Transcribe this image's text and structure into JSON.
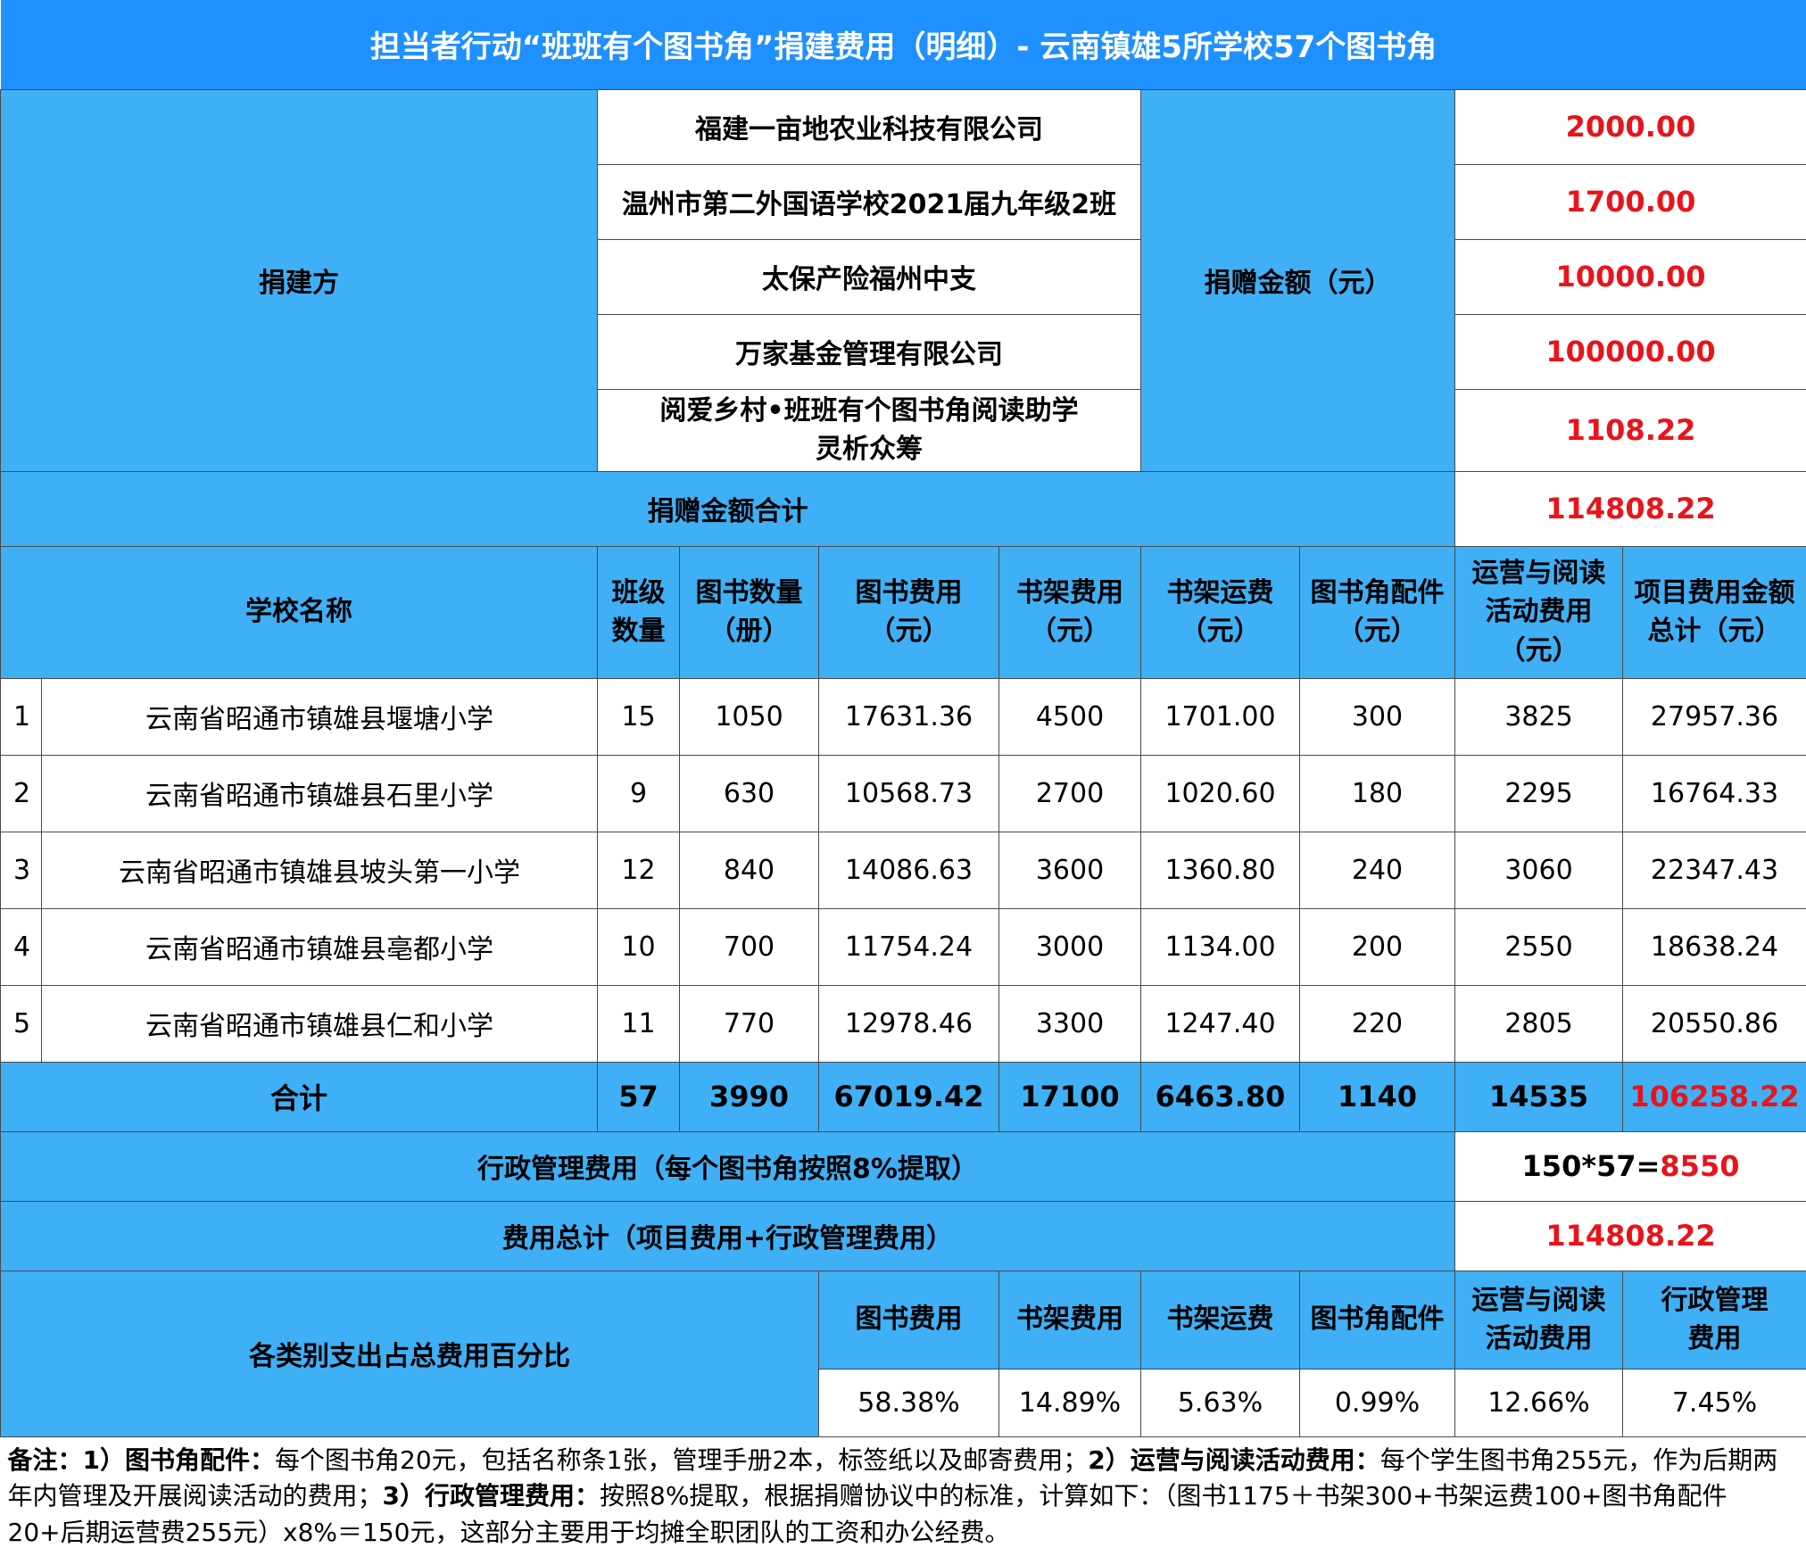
{
  "title": "担当者行动“班班有个图书角”捐建费用（明细）- 云南镇雄5所学校57个图书角",
  "donors": {
    "label": "捐建方",
    "amount_label": "捐赠金额（元）",
    "rows": [
      {
        "name": "福建一亩地农业科技有限公司",
        "amount": "2000.00"
      },
      {
        "name": "温州市第二外国语学校2021届九年级2班",
        "amount": "1700.00"
      },
      {
        "name": "太保产险福州中支",
        "amount": "10000.00"
      },
      {
        "name": "万家基金管理有限公司",
        "amount": "100000.00"
      },
      {
        "name_line1": "阅爱乡村•班班有个图书角阅读助学",
        "name_line2": "灵析众筹",
        "amount": "1108.22"
      }
    ],
    "total_label": "捐赠金额合计",
    "total": "114808.22"
  },
  "schools": {
    "headers": {
      "school": "学校名称",
      "classes_1": "班级",
      "classes_2": "数量",
      "books_1": "图书数量",
      "books_2": "（册）",
      "book_cost_1": "图书费用",
      "book_cost_2": "（元）",
      "shelf_cost_1": "书架费用",
      "shelf_cost_2": "（元）",
      "shelf_ship_1": "书架运费",
      "shelf_ship_2": "（元）",
      "accessory_1": "图书角配件",
      "accessory_2": "（元）",
      "ops_1": "运营与阅读",
      "ops_2": "活动费用",
      "ops_3": "（元）",
      "total_1": "项目费用金额",
      "total_2": "总计（元）"
    },
    "rows": [
      {
        "idx": "1",
        "name": "云南省昭通市镇雄县堰塘小学",
        "classes": "15",
        "books": "1050",
        "book_cost": "17631.36",
        "shelf_cost": "4500",
        "shelf_ship": "1701.00",
        "accessory": "300",
        "ops": "3825",
        "total": "27957.36"
      },
      {
        "idx": "2",
        "name": "云南省昭通市镇雄县石里小学",
        "classes": "9",
        "books": "630",
        "book_cost": "10568.73",
        "shelf_cost": "2700",
        "shelf_ship": "1020.60",
        "accessory": "180",
        "ops": "2295",
        "total": "16764.33"
      },
      {
        "idx": "3",
        "name": "云南省昭通市镇雄县坡头第一小学",
        "classes": "12",
        "books": "840",
        "book_cost": "14086.63",
        "shelf_cost": "3600",
        "shelf_ship": "1360.80",
        "accessory": "240",
        "ops": "3060",
        "total": "22347.43"
      },
      {
        "idx": "4",
        "name": "云南省昭通市镇雄县亳都小学",
        "classes": "10",
        "books": "700",
        "book_cost": "11754.24",
        "shelf_cost": "3000",
        "shelf_ship": "1134.00",
        "accessory": "200",
        "ops": "2550",
        "total": "18638.24"
      },
      {
        "idx": "5",
        "name": "云南省昭通市镇雄县仁和小学",
        "classes": "11",
        "books": "770",
        "book_cost": "12978.46",
        "shelf_cost": "3300",
        "shelf_ship": "1247.40",
        "accessory": "220",
        "ops": "2805",
        "total": "20550.86"
      }
    ],
    "sum": {
      "label": "合计",
      "classes": "57",
      "books": "3990",
      "book_cost": "67019.42",
      "shelf_cost": "17100",
      "shelf_ship": "6463.80",
      "accessory": "1140",
      "ops": "14535",
      "total": "106258.22"
    }
  },
  "admin": {
    "label": "行政管理费用（每个图书角按照8%提取）",
    "formula": "150*57=",
    "value": "8550"
  },
  "grand": {
    "label": "费用总计（项目费用+行政管理费用）",
    "value": "114808.22"
  },
  "percent": {
    "label": "各类别支出占总费用百分比",
    "headers": {
      "book": "图书费用",
      "shelf": "书架费用",
      "ship": "书架运费",
      "accessory": "图书角配件",
      "ops_1": "运营与阅读",
      "ops_2": "活动费用",
      "admin_1": "行政管理",
      "admin_2": "费用"
    },
    "values": {
      "book": "58.38%",
      "shelf": "14.89%",
      "ship": "5.63%",
      "accessory": "0.99%",
      "ops": "12.66%",
      "admin": "7.45%"
    }
  },
  "note": {
    "prefix": "备注：",
    "p1_title": "1）图书角配件：",
    "p1_text": "每个图书角20元，包括名称条1张，管理手册2本，标签纸以及邮寄费用；",
    "p2_title": "2）运营与阅读活动费用：",
    "p2_text": "每个学生图书角255元，作为后期两年内管理及开展阅读活动的费用；",
    "p3_title": "3）行政管理费用：",
    "p3_text": "按照8%提取，根据捐赠协议中的标准，计算如下：（图书1175＋书架300+书架运费100+图书角配件20+后期运营费255元）x8%＝150元，这部分主要用于均摊全职团队的工资和办公经费。"
  }
}
